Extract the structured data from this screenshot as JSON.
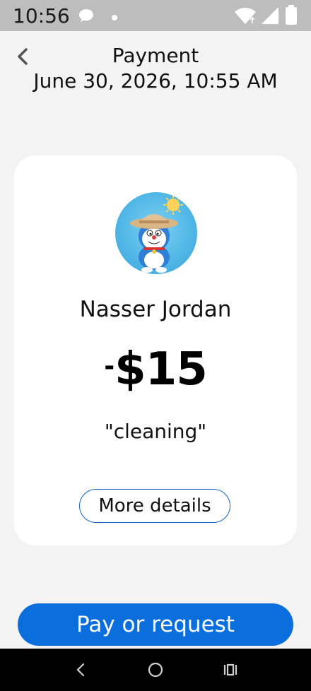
{
  "status_bar": {
    "time": "10:56"
  },
  "header": {
    "title": "Payment",
    "date": "June 30, 2026, 10:55 AM"
  },
  "card": {
    "name": "Nasser Jordan",
    "amount_sign": "-",
    "amount": "$15",
    "memo": "\"cleaning\"",
    "details_label": "More details"
  },
  "actions": {
    "pay_label": "Pay or request"
  },
  "colors": {
    "accent": "#0a6fdc",
    "outline": "#1565c0"
  },
  "icons": {
    "back": "chevron-left-icon",
    "nav_back": "triangle-back-icon",
    "nav_home": "circle-home-icon",
    "nav_recents": "recents-icon"
  }
}
